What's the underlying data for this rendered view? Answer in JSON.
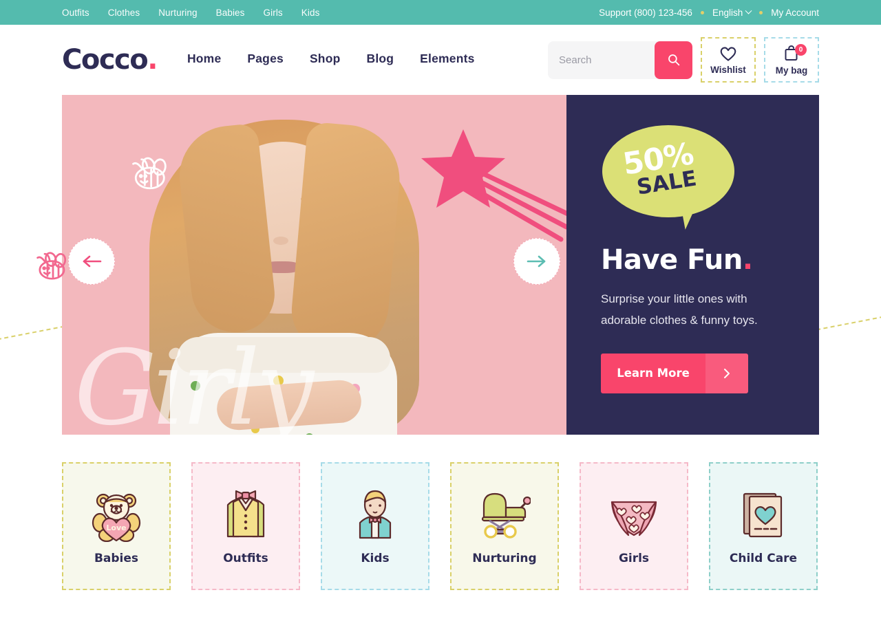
{
  "topbar": {
    "links": [
      {
        "label": "Outfits"
      },
      {
        "label": "Clothes"
      },
      {
        "label": "Nurturing"
      },
      {
        "label": "Babies"
      },
      {
        "label": "Girls"
      },
      {
        "label": "Kids"
      }
    ],
    "support": "Support (800) 123-456",
    "language": "English",
    "account": "My Account"
  },
  "header": {
    "logo_text": "Cocco",
    "logo_dot": ".",
    "nav": [
      {
        "label": "Home",
        "active": true
      },
      {
        "label": "Pages",
        "active": false
      },
      {
        "label": "Shop",
        "active": false
      },
      {
        "label": "Blog",
        "active": false
      },
      {
        "label": "Elements",
        "active": false
      }
    ],
    "search_placeholder": "Search",
    "search_value": "",
    "wishlist_label": "Wishlist",
    "bag_label": "My bag",
    "bag_count": "0"
  },
  "hero": {
    "script_overlay": "Girly",
    "badge_percent": "50%",
    "badge_sale": "SALE",
    "title": "Have Fun",
    "title_dot": ".",
    "subtitle": "Surprise your little ones with adorable clothes & funny toys.",
    "cta_label": "Learn More",
    "prev_label": "Previous slide",
    "next_label": "Next slide"
  },
  "categories": [
    {
      "label": "Babies",
      "bg": "#f7f8ec",
      "border": "#d9d069",
      "icon": "teddy-bear-icon"
    },
    {
      "label": "Outfits",
      "bg": "#fdeef2",
      "border": "#f5b9c8",
      "icon": "vest-icon"
    },
    {
      "label": "Kids",
      "bg": "#ecf8f8",
      "border": "#a6dbe8",
      "icon": "boy-icon"
    },
    {
      "label": "Nurturing",
      "bg": "#f8f8ea",
      "border": "#d9d069",
      "icon": "stroller-icon"
    },
    {
      "label": "Girls",
      "bg": "#fdeef2",
      "border": "#f5b9c8",
      "icon": "panties-icon"
    },
    {
      "label": "Child Care",
      "bg": "#ebf7f6",
      "border": "#8ecfc9",
      "icon": "care-book-icon"
    }
  ],
  "colors": {
    "teal": "#54bbae",
    "navy": "#2e2c55",
    "pink": "#f9456b",
    "lime": "#dbe076",
    "highlight": "#d6f4fb"
  }
}
